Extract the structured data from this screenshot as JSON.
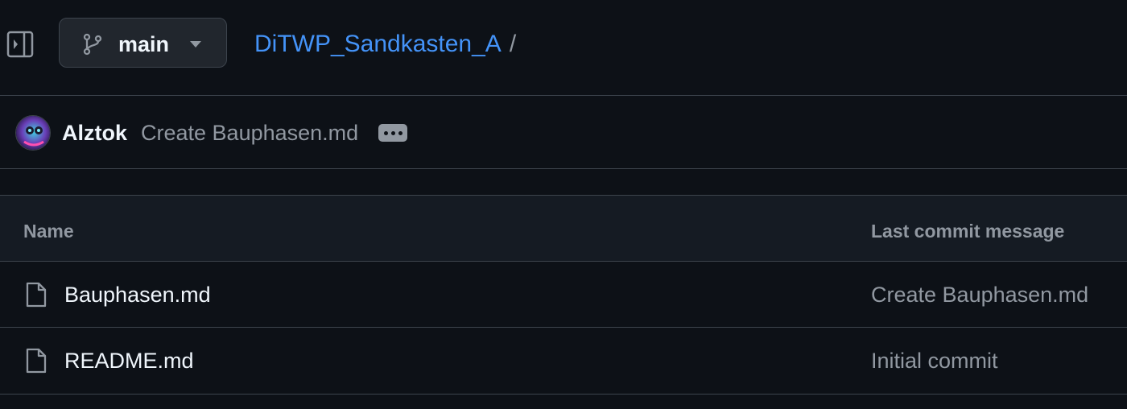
{
  "header": {
    "branch": "main",
    "repo_name": "DiTWP_Sandkasten_A",
    "separator": "/"
  },
  "latest_commit": {
    "author": "Alztok",
    "message": "Create Bauphasen.md"
  },
  "file_table": {
    "columns": [
      "Name",
      "Last commit message"
    ],
    "rows": [
      {
        "name": "Bauphasen.md",
        "commit_message": "Create Bauphasen.md",
        "icon": "file-icon"
      },
      {
        "name": "README.md",
        "commit_message": "Initial commit",
        "icon": "file-icon"
      }
    ]
  },
  "colors": {
    "background": "#0d1117",
    "link": "#4493f8",
    "border": "#3d444d",
    "muted_text": "#9198a1",
    "header_bg": "#151b23"
  }
}
